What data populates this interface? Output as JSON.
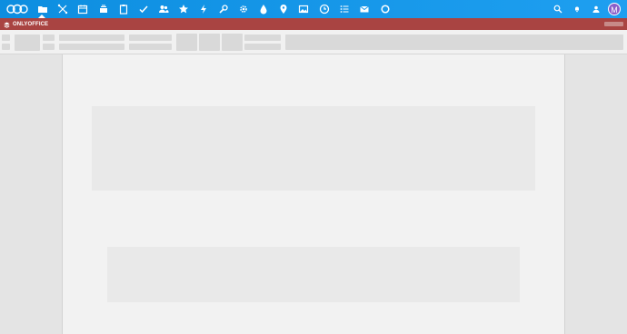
{
  "topbar": {
    "accent": "#1a9aed",
    "apps": [
      {
        "name": "files",
        "icon": "folder-icon"
      },
      {
        "name": "activity",
        "icon": "flow-icon"
      },
      {
        "name": "calendar",
        "icon": "calendar-icon"
      },
      {
        "name": "deck",
        "icon": "deck-icon"
      },
      {
        "name": "notes",
        "icon": "clipboard-icon"
      },
      {
        "name": "tasks",
        "icon": "check-icon"
      },
      {
        "name": "contacts",
        "icon": "contacts-icon"
      },
      {
        "name": "favorites",
        "icon": "star-icon"
      },
      {
        "name": "activity-flash",
        "icon": "lightning-icon"
      },
      {
        "name": "tools",
        "icon": "wrench-icon"
      },
      {
        "name": "settings",
        "icon": "cog-icon"
      },
      {
        "name": "drops",
        "icon": "drop-icon"
      },
      {
        "name": "maps",
        "icon": "map-pin-icon"
      },
      {
        "name": "photos",
        "icon": "image-icon"
      },
      {
        "name": "clock",
        "icon": "clock-icon"
      },
      {
        "name": "lists",
        "icon": "list-icon"
      },
      {
        "name": "mail",
        "icon": "mail-icon"
      },
      {
        "name": "circles",
        "icon": "circle-icon"
      }
    ],
    "right_icons": [
      "search-icon",
      "notifications-icon",
      "contacts-menu-icon"
    ],
    "avatar_initial": "M",
    "avatar_color": "#8a5fc9"
  },
  "docbar": {
    "brand": "ONLYOFFICE",
    "color": "#a94442"
  }
}
